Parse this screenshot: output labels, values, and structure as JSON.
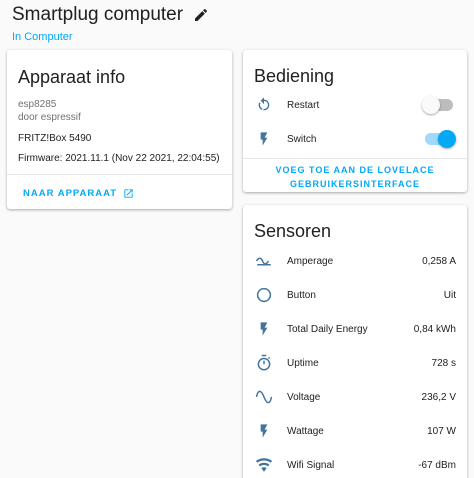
{
  "header": {
    "title": "Smartplug computer",
    "subtitle": "In Computer"
  },
  "info": {
    "title": "Apparaat info",
    "model": "esp8285",
    "manufacturer": "door espressif",
    "via": "FRITZ!Box 5490",
    "firmware": "Firmware: 2021.11.1 (Nov 22 2021, 22:04:55)",
    "link": "NAAR APPARAAT"
  },
  "control": {
    "title": "Bediening",
    "items": [
      {
        "label": "Restart",
        "icon": "restart-icon",
        "state": "off"
      },
      {
        "label": "Switch",
        "icon": "flash-icon",
        "state": "on"
      }
    ],
    "add_button_line1": "VOEG TOE AAN DE LOVELACE",
    "add_button_line2": "GEBRUIKERSINTERFACE"
  },
  "sensors": {
    "title": "Sensoren",
    "items": [
      {
        "label": "Amperage",
        "value": "0,258 A",
        "icon": "current-ac-icon"
      },
      {
        "label": "Button",
        "value": "Uit",
        "icon": "circle-outline-icon"
      },
      {
        "label": "Total Daily Energy",
        "value": "0,84 kWh",
        "icon": "flash-icon"
      },
      {
        "label": "Uptime",
        "value": "728 s",
        "icon": "timer-icon"
      },
      {
        "label": "Voltage",
        "value": "236,2 V",
        "icon": "sine-wave-icon"
      },
      {
        "label": "Wattage",
        "value": "107 W",
        "icon": "flash-icon"
      },
      {
        "label": "Wifi Signal",
        "value": "-67 dBm",
        "icon": "wifi-icon"
      }
    ]
  },
  "colors": {
    "accent": "#03a9f4",
    "icon": "#44739e",
    "background": "#fafafa"
  }
}
